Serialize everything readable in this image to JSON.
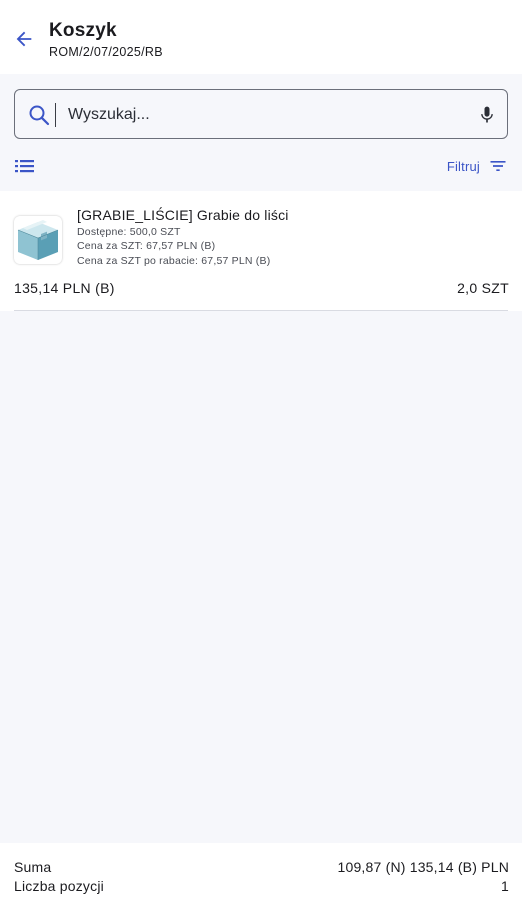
{
  "header": {
    "title": "Koszyk",
    "subtitle": "ROM/2/07/2025/RB",
    "back_icon": "arrow-back-icon",
    "accent_color": "#3b55c7"
  },
  "search": {
    "placeholder": "Wyszukaj...",
    "value": "",
    "icons": [
      "search-icon",
      "mic-icon"
    ]
  },
  "toolbar": {
    "view_icon": "list-view-icon",
    "filter_label": "Filtruj",
    "filter_icon": "filter-icon"
  },
  "cart_items": [
    {
      "name": "[GRABIE_LIŚCIE] Grabie do liści",
      "available": "Dostępne: 500,0 SZT",
      "unit_price": "Cena za SZT: 67,57 PLN (B)",
      "unit_price_discount": "Cena za SZT po rabacie: 67,57 PLN (B)",
      "total": "135,14 PLN (B)",
      "quantity": "2,0 SZT",
      "thumbnail_icon": "product-box-icon"
    }
  ],
  "footer": {
    "sum_label": "Suma",
    "sum_value": "109,87 (N) 135,14 (B) PLN",
    "count_label": "Liczba pozycji",
    "count_value": "1"
  }
}
